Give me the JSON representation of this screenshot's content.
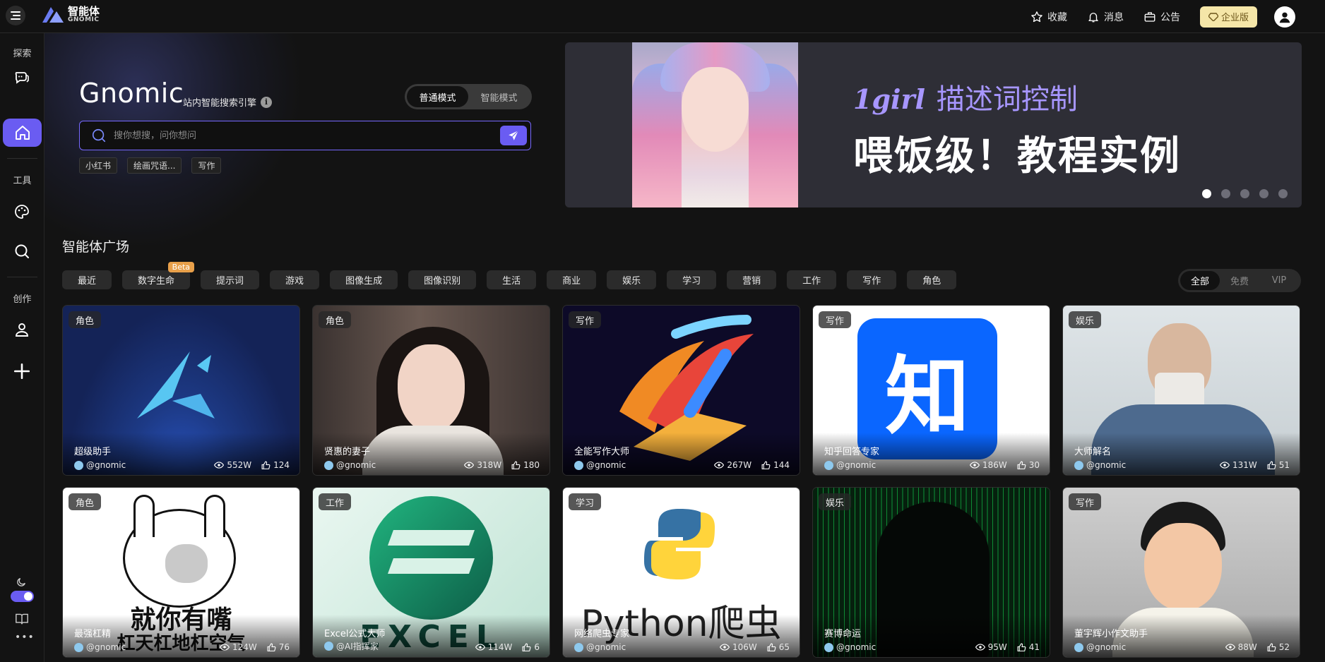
{
  "logo": {
    "cn": "智能体",
    "en": "GNOMIC"
  },
  "topbar": {
    "favorites": "收藏",
    "messages": "消息",
    "announce": "公告",
    "enterprise": "企业版"
  },
  "sidebar": {
    "explore": "探索",
    "tools": "工具",
    "create": "创作"
  },
  "hero": {
    "title": "Gnomic",
    "subtitle": "站内智能搜索引擎",
    "info_icon": "i",
    "mode_normal": "普通模式",
    "mode_smart": "智能模式",
    "search_placeholder": "搜你想搜，问你想问",
    "tags": [
      "小红书",
      "绘画咒语...",
      "写作"
    ]
  },
  "banner": {
    "line1_en": "1girl",
    "line1_cn": "描述词控制",
    "line2": "喂饭级！教程实例",
    "slide_count": 5,
    "active_slide": 0
  },
  "section": {
    "title": "智能体广场"
  },
  "categories": [
    "最近",
    "数字生命",
    "提示词",
    "游戏",
    "图像生成",
    "图像识别",
    "生活",
    "商业",
    "娱乐",
    "学习",
    "营销",
    "工作",
    "写作",
    "角色"
  ],
  "beta_label": "Beta",
  "filters": [
    "全部",
    "免费",
    "VIP"
  ],
  "cards": [
    {
      "cat": "角色",
      "name": "超级助手",
      "author": "@gnomic",
      "views": "552W",
      "likes": "124",
      "bg": "#1b2a5a"
    },
    {
      "cat": "角色",
      "name": "贤惠的妻子",
      "author": "@gnomic",
      "views": "318W",
      "likes": "180",
      "bg": "#6b5a52"
    },
    {
      "cat": "写作",
      "name": "全能写作大师",
      "author": "@gnomic",
      "views": "267W",
      "likes": "144",
      "bg": "#0d0a28"
    },
    {
      "cat": "写作",
      "name": "知乎回答专家",
      "author": "@gnomic",
      "views": "186W",
      "likes": "30",
      "bg": "#ffffff"
    },
    {
      "cat": "娱乐",
      "name": "大师解名",
      "author": "@gnomic",
      "views": "131W",
      "likes": "51",
      "bg": "#c9cfd2"
    },
    {
      "cat": "角色",
      "name": "最强杠精",
      "author": "@gnomic",
      "views": "124W",
      "likes": "76",
      "bg": "#ffffff"
    },
    {
      "cat": "工作",
      "name": "Excel公式大师",
      "author": "@AI指挥家",
      "views": "114W",
      "likes": "6",
      "bg": "#d7efe6"
    },
    {
      "cat": "学习",
      "name": "网络爬虫专家",
      "author": "@gnomic",
      "views": "106W",
      "likes": "65",
      "bg": "#ffffff"
    },
    {
      "cat": "娱乐",
      "name": "赛博命运",
      "author": "@gnomic",
      "views": "95W",
      "likes": "41",
      "bg": "#06200e"
    },
    {
      "cat": "写作",
      "name": "董宇辉小作文助手",
      "author": "@gnomic",
      "views": "88W",
      "likes": "52",
      "bg": "#b8b8b8"
    }
  ],
  "card_art": {
    "zhihu_char": "知",
    "meme_text1": "就你有嘴",
    "meme_text2": "杠天杠地杠空气",
    "excel_text": "EXCEL",
    "python_text": "Python爬虫"
  },
  "colors": {
    "accent": "#6a5cf2",
    "enterprise": "#f5e6a8",
    "beta": "#e8a04a"
  }
}
